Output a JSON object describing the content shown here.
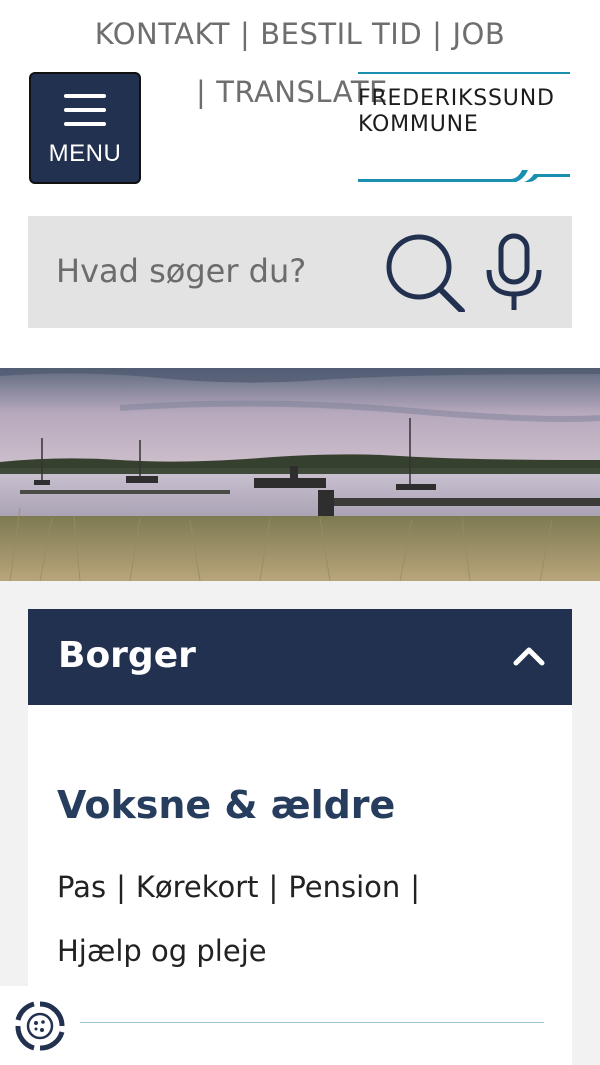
{
  "top_links": {
    "items": [
      "KONTAKT",
      "BESTIL TID",
      "JOB",
      "TRANSLATE"
    ],
    "separator": "|"
  },
  "menu": {
    "label": "MENU"
  },
  "logo": {
    "line1": "FREDERIKSSUND",
    "line2": "KOMMUNE",
    "accent_color": "#1a8fb0"
  },
  "search": {
    "placeholder": "Hvad søger du?",
    "search_icon": "search-icon",
    "mic_icon": "microphone-icon"
  },
  "hero": {
    "description_icon": "landscape-photo"
  },
  "section": {
    "title": "Borger",
    "expanded": true,
    "subsection_title": "Voksne & ældre",
    "links": [
      "Pas",
      "Kørekort",
      "Pension",
      "Hjælp og pleje"
    ]
  },
  "colors": {
    "navy": "#22314f",
    "heading": "#263d5e",
    "search_bg": "#e3e3e3",
    "band_bg": "#f2f2f2"
  }
}
